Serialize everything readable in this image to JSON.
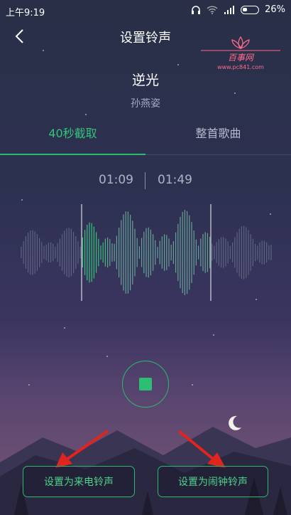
{
  "status_bar": {
    "time": "上午9:19",
    "battery": "26%"
  },
  "header": {
    "title": "设置铃声",
    "back_icon": "chevron-left-icon"
  },
  "watermark": {
    "brand": "百事网",
    "url": "www.pc841.com"
  },
  "song": {
    "title": "逆光",
    "artist": "孙燕姿"
  },
  "tabs": [
    {
      "label": "40秒截取",
      "active": true
    },
    {
      "label": "整首歌曲",
      "active": false
    }
  ],
  "clip": {
    "start": "01:09",
    "end": "01:49"
  },
  "player": {
    "state": "playing",
    "control_icon": "stop-icon"
  },
  "actions": {
    "incoming_call": "设置为来电铃声",
    "alarm": "设置为闹钟铃声"
  },
  "colors": {
    "accent": "#2cb86e",
    "arrow": "#e0241e",
    "watermark": "#ff6a8a"
  }
}
